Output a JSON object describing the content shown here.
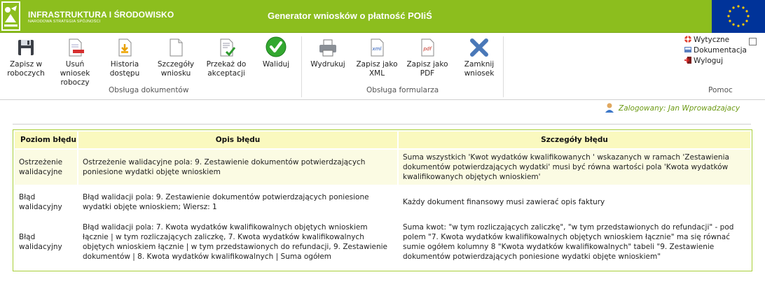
{
  "header": {
    "logo_title": "INFRASTRUKTURA I ŚRODOWISKO",
    "logo_subtitle": "NARODOWA STRATEGIA SPÓJNOŚCI",
    "app_title": "Generator wniosków o płatność POIiŚ"
  },
  "toolbar": {
    "buttons": [
      {
        "label": "Zapisz w\nroboczych",
        "icon": "floppy-disk-icon"
      },
      {
        "label": "Usuń\nwniosek\nroboczy",
        "icon": "delete-document-icon"
      },
      {
        "label": "Historia\ndostępu",
        "icon": "history-document-icon"
      },
      {
        "label": "Szczegóły\nwniosku",
        "icon": "blank-document-icon"
      },
      {
        "label": "Przekaż do\nakceptacji",
        "icon": "document-check-icon"
      },
      {
        "label": "Waliduj",
        "icon": "green-check-icon"
      },
      {
        "label": "Wydrukuj",
        "icon": "printer-icon"
      },
      {
        "label": "Zapisz jako\nXML",
        "icon": "xml-file-icon"
      },
      {
        "label": "Zapisz jako\nPDF",
        "icon": "pdf-file-icon"
      },
      {
        "label": "Zamknij\nwniosek",
        "icon": "close-x-icon"
      }
    ],
    "groups": {
      "documents": "Obsługa dokumentów",
      "form": "Obsługa formularza",
      "help": "Pomoc"
    },
    "help_links": [
      {
        "label": "Wytyczne",
        "icon": "lifebuoy-icon"
      },
      {
        "label": "Dokumentacja",
        "icon": "documentation-icon"
      },
      {
        "label": "Wyloguj",
        "icon": "logout-icon"
      }
    ]
  },
  "login": {
    "text": "Zalogowany: Jan Wprowadzajacy"
  },
  "errors_table": {
    "headers": [
      "Poziom błędu",
      "Opis błędu",
      "Szczegóły błędu"
    ],
    "rows": [
      {
        "level": "Ostrzeżenie walidacyjne",
        "description": "Ostrzeżenie walidacyjne pola: 9. Zestawienie dokumentów potwierdzających poniesione wydatki objęte wnioskiem",
        "details": "Suma wszystkich 'Kwot wydatków kwalifikowanych ' wskazanych w ramach 'Zestawienia dokumentów potwierdzających wydatki' musi być równa wartości pola 'Kwota wydatków kwalifikowanych objętych wnioskiem'"
      },
      {
        "level": "Błąd walidacyjny",
        "description": "Błąd walidacji pola: 9. Zestawienie dokumentów potwierdzających poniesione wydatki objęte wnioskiem; Wiersz: 1",
        "details": "Każdy dokument finansowy musi zawierać opis faktury"
      },
      {
        "level": "Błąd walidacyjny",
        "description": "Błąd walidacji pola: 7. Kwota wydatków kwalifikowalnych objętych wnioskiem łącznie | w tym rozliczających zaliczkę, 7. Kwota wydatków kwalifikowalnych objętych wnioskiem łącznie | w tym przedstawionych do refundacji, 9. Zestawienie dokumentów | 8. Kwota wydatków kwalifikowalnych | Suma ogółem",
        "details": "Suma kwot: \"w tym rozliczających zaliczkę\", \"w tym przedstawionych do refundacji\" - pod polem \"7. Kwota wydatków kwalifikowalnych objętych wnioskiem łącznie\" ma się równać sumie ogółem kolumny 8 \"Kwota wydatków kwalifikowalnych\" tabeli \"9. Zestawienie dokumentów potwierdzających poniesione wydatki objęte wnioskiem\""
      }
    ]
  },
  "colors": {
    "header_green": "#8cbe1e",
    "eu_blue": "#003399",
    "table_header_bg": "#faf9bf",
    "table_border": "#a8cf38",
    "login_text": "#6c9a14"
  }
}
